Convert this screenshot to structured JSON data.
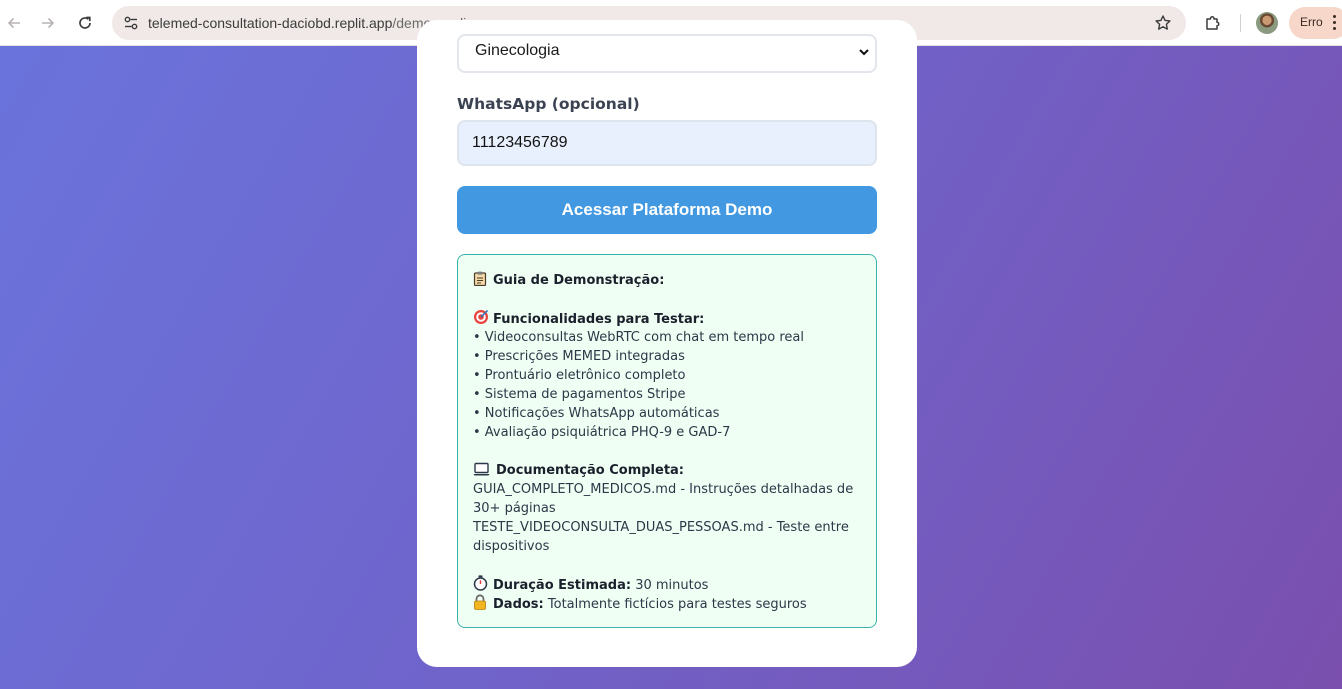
{
  "browser": {
    "url_host": "telemed-consultation-daciobd.replit.app",
    "url_path": "/demo-medico",
    "error_label": "Erro",
    "icons": {
      "back": "back-arrow-icon",
      "forward": "forward-arrow-icon",
      "reload": "reload-icon",
      "site_info": "site-settings-icon",
      "bookmark": "star-icon",
      "extensions": "puzzle-icon",
      "menu": "vertical-dots-icon"
    }
  },
  "form": {
    "specialty_value": "Ginecologia",
    "whatsapp_label": "WhatsApp (opcional)",
    "whatsapp_value": "11123456789",
    "submit_label": "Acessar Plataforma Demo"
  },
  "guide": {
    "title": "Guia de Demonstração:",
    "features_title": "Funcionalidades para Testar:",
    "features": [
      "• Videoconsultas WebRTC com chat em tempo real",
      "• Prescrições MEMED integradas",
      "• Prontuário eletrônico completo",
      "• Sistema de pagamentos Stripe",
      "• Notificações WhatsApp automáticas",
      "• Avaliação psiquiátrica PHQ-9 e GAD-7"
    ],
    "docs_title": "Documentação Completa:",
    "docs_lines": [
      "GUIA_COMPLETO_MEDICOS.md - Instruções detalhadas de",
      "30+ páginas",
      "TESTE_VIDEOCONSULTA_DUAS_PESSOAS.md - Teste entre",
      "dispositivos"
    ],
    "duration_label": "Duração Estimada:",
    "duration_value": " 30 minutos",
    "data_label": "Dados:",
    "data_value": " Totalmente fictícios para testes seguros",
    "icons": {
      "title": "clipboard-icon",
      "features": "target-icon",
      "docs": "laptop-icon",
      "duration": "stopwatch-icon",
      "data": "lock-icon"
    }
  },
  "colors": {
    "primary_button": "#4299e1",
    "guide_border": "#38b2ac",
    "guide_background": "#f0fff4",
    "gradient_start": "#6a74dc",
    "gradient_end": "#7a4fae"
  }
}
